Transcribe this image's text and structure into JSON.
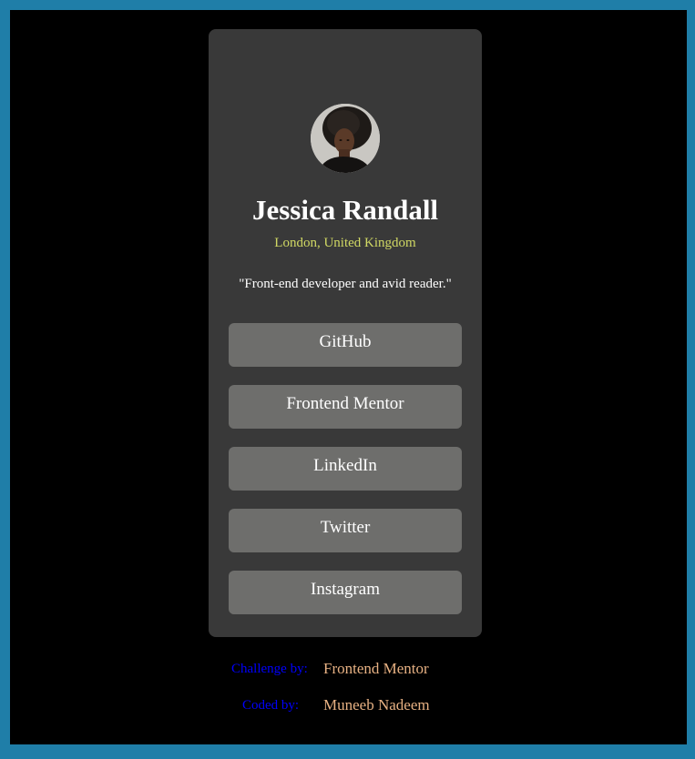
{
  "profile": {
    "name": "Jessica Randall",
    "location": "London, United Kingdom",
    "bio": "\"Front-end developer and avid reader.\"",
    "avatar_icon": "profile-photo"
  },
  "links": [
    {
      "label": "GitHub"
    },
    {
      "label": "Frontend Mentor"
    },
    {
      "label": "LinkedIn"
    },
    {
      "label": "Twitter"
    },
    {
      "label": "Instagram"
    }
  ],
  "attribution": {
    "challenge_label": "Challenge by:",
    "challenge_value": "Frontend Mentor",
    "coded_label": "Coded by:",
    "coded_value": "Muneeb Nadeem"
  },
  "colors": {
    "outer_border": "#1f7ea8",
    "background": "#000000",
    "card": "#393939",
    "button": "#6e6e6c",
    "location": "#d1d964",
    "attribution_label": "#0000ff",
    "attribution_value": "#e7b183"
  }
}
